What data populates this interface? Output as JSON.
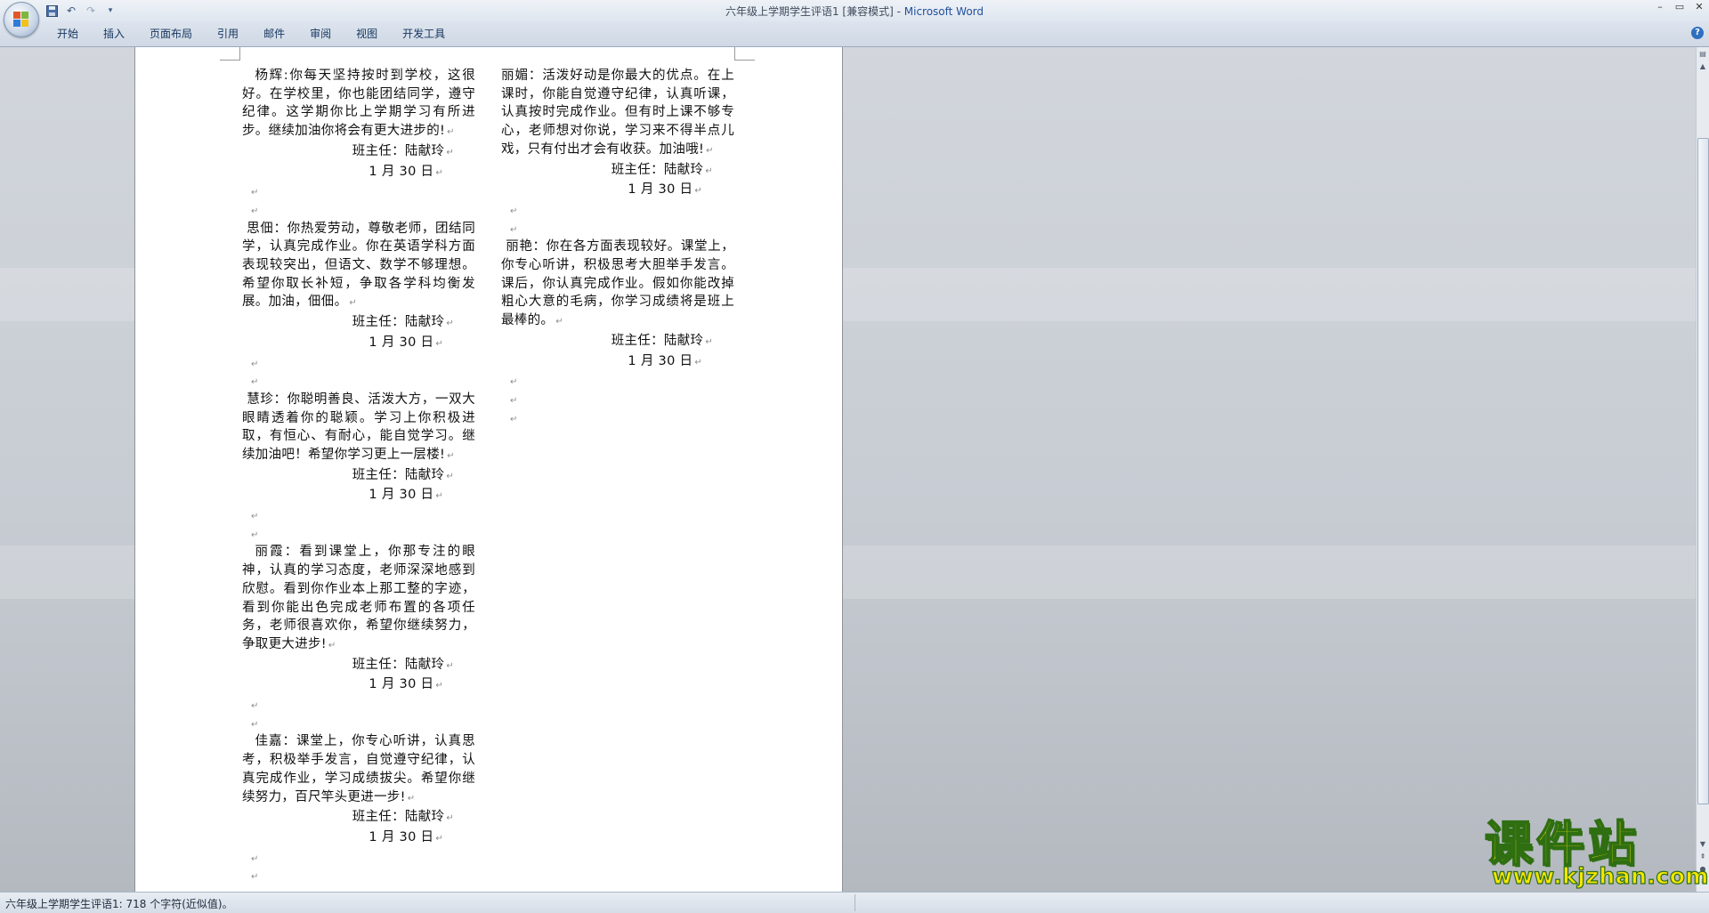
{
  "window": {
    "title_doc": "六年级上学期学生评语1 [兼容模式] - ",
    "title_app": "Microsoft Word"
  },
  "ribbon": {
    "tabs": [
      "开始",
      "插入",
      "页面布局",
      "引用",
      "邮件",
      "审阅",
      "视图",
      "开发工具"
    ]
  },
  "document": {
    "left_column": [
      {
        "indent": true,
        "text": "杨辉:你每天坚持按时到学校，这很好。在学校里，你也能团结同学，遵守纪律。这学期你比上学期学习有所进步。继续加油你将会有更大进步的!",
        "sig": "班主任：陆献玲",
        "date": "1 月 30 日",
        "blank": 2
      },
      {
        "indent": false,
        "text": " 思佃：你热爱劳动，尊敬老师，团结同学，认真完成作业。你在英语学科方面表现较突出，但语文、数学不够理想。希望你取长补短，争取各学科均衡发展。加油，佃佃。",
        "sig": "班主任：陆献玲",
        "date": "1 月 30 日",
        "blank": 2
      },
      {
        "indent": false,
        "text": " 慧珍：你聪明善良、活泼大方，一双大眼睛透着你的聪颖。学习上你积极进取，有恒心、有耐心，能自觉学习。继续加油吧！希望你学习更上一层楼!",
        "sig": "班主任：陆献玲",
        "date": "1 月 30 日",
        "blank": 2
      },
      {
        "indent": true,
        "text": "丽霞：看到课堂上，你那专注的眼神，认真的学习态度，老师深深地感到欣慰。看到你作业本上那工整的字迹，看到你能出色完成老师布置的各项任务，老师很喜欢你，希望你继续努力，争取更大进步!",
        "sig": "班主任：陆献玲",
        "date": "1 月 30 日",
        "blank": 2
      },
      {
        "indent": true,
        "text": "佳嘉：课堂上，你专心听讲，认真思考，积极举手发言，自觉遵守纪律，认真完成作业，学习成绩拔尖。希望你继续努力，百尺竿头更进一步!",
        "sig": "班主任：陆献玲",
        "date": "1 月 30 日",
        "blank": 3
      }
    ],
    "right_column": [
      {
        "indent": false,
        "text": "丽媚：活泼好动是你最大的优点。在上课时，你能自觉遵守纪律，认真听课，认真按时完成作业。但有时上课不够专心，老师想对你说，学习来不得半点儿戏，只有付出才会有收获。加油哦!",
        "sig": "班主任：陆献玲",
        "date": "1 月 30 日",
        "blank": 2
      },
      {
        "indent": false,
        "text": " 丽艳：你在各方面表现较好。课堂上，你专心听讲，积极思考大胆举手发言。课后，你认真完成作业。假如你能改掉粗心大意的毛病，你学习成绩将是班上最棒的。",
        "sig": "班主任：陆献玲",
        "date": "1 月 30 日",
        "blank": 3
      }
    ],
    "paragraph_mark": "↵"
  },
  "statusbar": {
    "text": "六年级上学期学生评语1: 718 个字符(近似值)。"
  },
  "watermark": {
    "title": "课件站",
    "url": "www.kjzhan.com"
  },
  "colors": {
    "accent": "#1f4f9c",
    "watermark_fill": "#f5e600",
    "watermark_stroke": "#2f6f12"
  },
  "icons": [
    "office-logo-icon",
    "save-icon",
    "undo-icon",
    "redo-icon",
    "customize-qat-icon",
    "minimize-icon",
    "maximize-icon",
    "close-icon",
    "help-icon",
    "scroll-up-icon",
    "scroll-down-icon",
    "prev-page-icon",
    "select-browse-object-icon",
    "next-page-icon",
    "ruler-toggle-icon"
  ]
}
